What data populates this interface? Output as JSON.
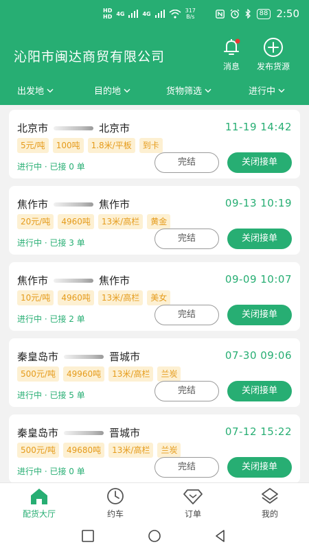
{
  "status_bar": {
    "carrier_top": "HD",
    "carrier_bottom": "HD",
    "net1": "4G",
    "net2": "4G",
    "speed_value": "317",
    "speed_unit": "B/s",
    "battery": "88",
    "time": "2:50"
  },
  "header": {
    "company": "沁阳市闽达商贸有限公司",
    "message_label": "消息",
    "publish_label": "发布货源"
  },
  "filters": [
    {
      "label": "出发地"
    },
    {
      "label": "目的地"
    },
    {
      "label": "货物筛选"
    },
    {
      "label": "进行中"
    }
  ],
  "orders": [
    {
      "from": "北京市",
      "to": "北京市",
      "time": "11-19 14:42",
      "tags": [
        "5元/吨",
        "100吨",
        "1.8米/平板",
        "到卡"
      ],
      "status": "进行中 · 已接 0 单",
      "finish_label": "完结",
      "close_label": "关闭接单"
    },
    {
      "from": "焦作市",
      "to": "焦作市",
      "time": "09-13 10:19",
      "tags": [
        "20元/吨",
        "4960吨",
        "13米/高栏",
        "黄金"
      ],
      "status": "进行中 · 已接 3 单",
      "finish_label": "完结",
      "close_label": "关闭接单"
    },
    {
      "from": "焦作市",
      "to": "焦作市",
      "time": "09-09 10:07",
      "tags": [
        "10元/吨",
        "4960吨",
        "13米/高栏",
        "美女"
      ],
      "status": "进行中 · 已接 2 单",
      "finish_label": "完结",
      "close_label": "关闭接单"
    },
    {
      "from": "秦皇岛市",
      "to": "晋城市",
      "time": "07-30 09:06",
      "tags": [
        "500元/吨",
        "49960吨",
        "13米/高栏",
        "兰炭"
      ],
      "status": "进行中 · 已接 5 单",
      "finish_label": "完结",
      "close_label": "关闭接单"
    },
    {
      "from": "秦皇岛市",
      "to": "晋城市",
      "time": "07-12 15:22",
      "tags": [
        "500元/吨",
        "49680吨",
        "13米/高栏",
        "兰炭"
      ],
      "status": "进行中 · 已接 0 单",
      "finish_label": "完结",
      "close_label": "关闭接单"
    }
  ],
  "tabs": [
    {
      "label": "配货大厅",
      "icon": "home-icon",
      "active": true
    },
    {
      "label": "约车",
      "icon": "clock-icon",
      "active": false
    },
    {
      "label": "订单",
      "icon": "diamond-icon",
      "active": false
    },
    {
      "label": "我的",
      "icon": "profile-icon",
      "active": false
    }
  ],
  "colors": {
    "brand": "#27ae73",
    "tag_bg": "#fdf0d2",
    "tag_text": "#e59b1b"
  }
}
